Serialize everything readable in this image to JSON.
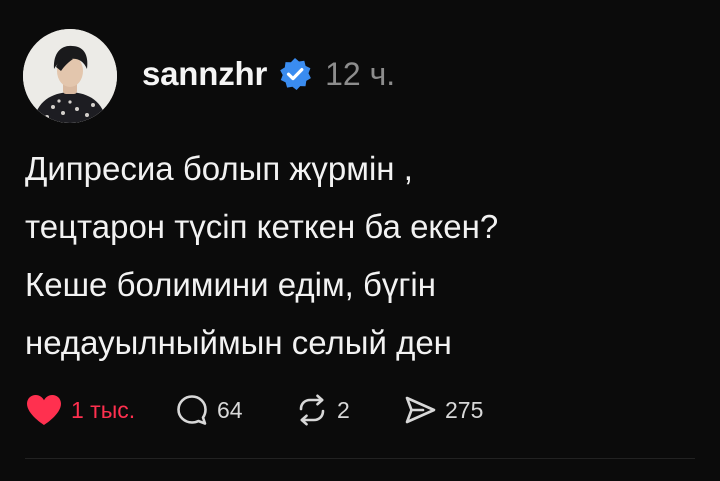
{
  "post": {
    "username": "sannzhr",
    "time": "12 ч.",
    "text_lines": [
      "Дипресиа болып жүрмін ,",
      "тецтарон түсіп кеткен ба екен?",
      "Кеше болимини едім, бүгін",
      "недауылныймын селый ден"
    ]
  },
  "actions": {
    "likes": "1 тыс.",
    "replies": "64",
    "reposts": "2",
    "shares": "275"
  },
  "colors": {
    "background": "#0b0b0b",
    "like": "#ff304f",
    "verified": "#3a8cf0",
    "muted": "#8d8d8d"
  }
}
